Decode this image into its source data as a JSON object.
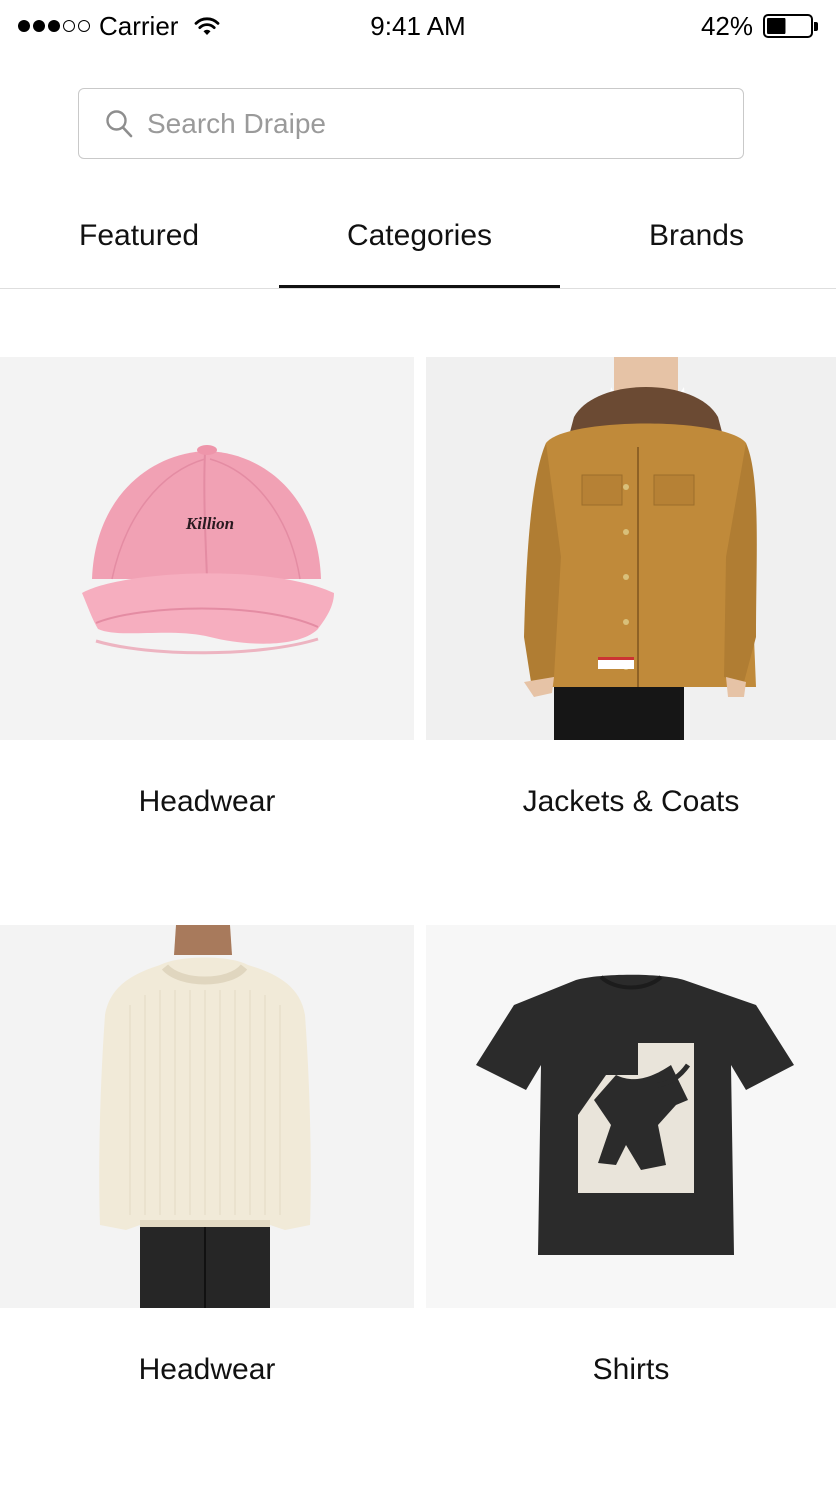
{
  "status_bar": {
    "carrier": "Carrier",
    "time": "9:41 AM",
    "battery_percent": "42%",
    "battery_level": 0.42,
    "signal_bars_filled": 3,
    "signal_bars_total": 5
  },
  "search": {
    "placeholder": "Search Draipe",
    "value": ""
  },
  "tabs": [
    {
      "label": "Featured",
      "active": false
    },
    {
      "label": "Categories",
      "active": true
    },
    {
      "label": "Brands",
      "active": false
    }
  ],
  "categories": [
    {
      "label": "Headwear",
      "image": "pink-cap",
      "image_text": "Killion"
    },
    {
      "label": "Jackets & Coats",
      "image": "tan-jacket"
    },
    {
      "label": "Headwear",
      "image": "cream-sweater"
    },
    {
      "label": "Shirts",
      "image": "black-graphic-tshirt"
    }
  ],
  "colors": {
    "accent": "#111111",
    "divider": "#dedede",
    "placeholder": "#9a9a9a",
    "tile_background": "#f3f3f3",
    "cap": "#f1a1b4",
    "jacket": "#c08a3a",
    "sweater": "#f1ead8",
    "tshirt": "#2b2b2b"
  }
}
